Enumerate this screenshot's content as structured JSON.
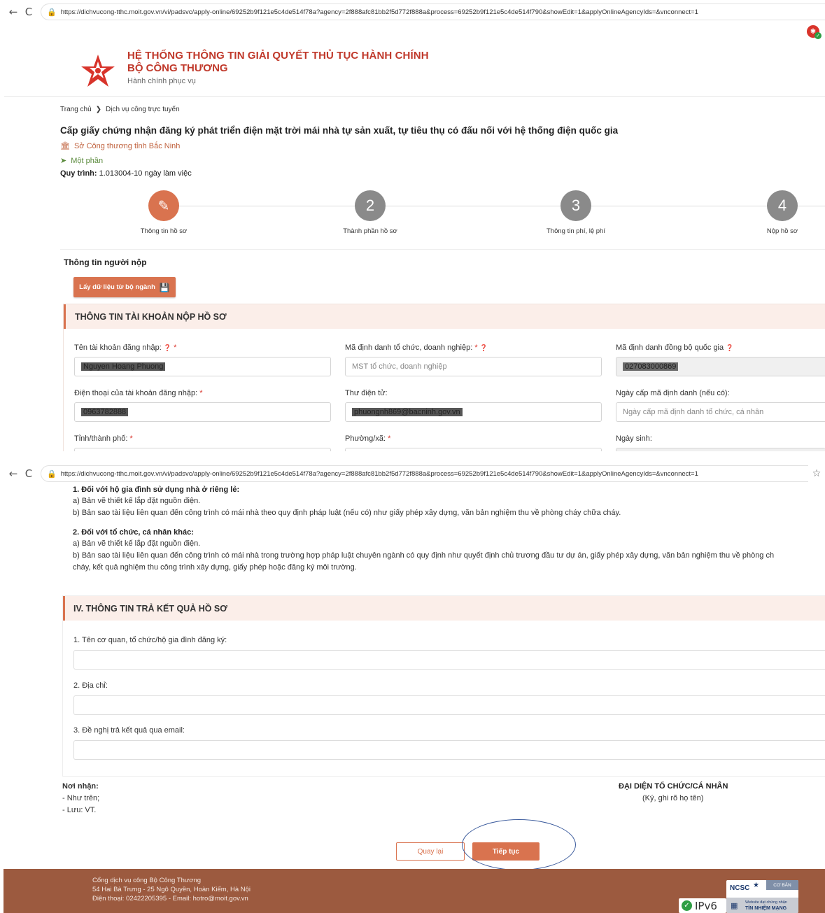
{
  "browser": {
    "url": "https://dichvucong-tthc.moit.gov.vn/vi/padsvc/apply-online/69252b9f121e5c4de514f78a?agency=2f888afc81bb2f5d772f888a&process=69252b9f121e5c4de514f790&showEdit=1&applyOnlineAgencyIds=&vnconnect=1",
    "back_glyph": "←",
    "reload_glyph": "C",
    "lock_glyph": "🔒",
    "star_glyph": "☆"
  },
  "header": {
    "title_line1": "HỆ THỐNG THÔNG TIN GIẢI QUYẾT THỦ TỤC HÀNH CHÍNH",
    "title_line2": "BỘ CÔNG THƯƠNG",
    "subtitle": "Hành chính phục vụ"
  },
  "breadcrumb": {
    "home": "Trang chủ",
    "separator": "❯",
    "current": "Dịch vụ công trực tuyến"
  },
  "procedure": {
    "title": "Cấp giấy chứng nhận đăng ký phát triển điện mặt trời mái nhà tự sản xuất, tự tiêu thụ có đấu nối với hệ thống điện quốc gia",
    "agency": "Sở Công thương tỉnh Bắc Ninh",
    "agency_icon": "🏛",
    "level": "Một phần",
    "level_icon": "➤",
    "process_label": "Quy trình:",
    "process_value": "1.013004-10 ngày làm việc"
  },
  "steps": [
    {
      "number": "✎",
      "label": "Thông tin hồ sơ",
      "active": true
    },
    {
      "number": "2",
      "label": "Thành phần hồ sơ",
      "active": false
    },
    {
      "number": "3",
      "label": "Thông tin phí, lệ phí",
      "active": false
    },
    {
      "number": "4",
      "label": "Nộp hồ sơ",
      "active": false
    }
  ],
  "submitter": {
    "section_title": "Thông tin người nộp",
    "fetch_button": "Lấy dữ liệu từ bộ ngành",
    "fetch_icon": "💾"
  },
  "account_panel": {
    "title": "THÔNG TIN TÀI KHOẢN NỘP HỒ SƠ",
    "help_glyph": "❓",
    "required_mark": "*",
    "fields": {
      "username": {
        "label": "Tên tài khoản đăng nhập:",
        "value": "Nguyen Hoang Phuong"
      },
      "org_id": {
        "label": "Mã định danh tổ chức, doanh nghiệp:",
        "placeholder": "MST tổ chức, doanh nghiệp"
      },
      "national_id": {
        "label": "Mã định danh đồng bộ quốc gia",
        "value": "027083000869"
      },
      "phone": {
        "label": "Điện thoại của tài khoản đăng nhập:",
        "value": "0963782888"
      },
      "email": {
        "label": "Thư điện tử:",
        "value": "phuongnh869@bacninh.gov.vn"
      },
      "id_date": {
        "label": "Ngày cấp mã định danh (nếu có):",
        "placeholder": "Ngày cấp mã định danh tổ chức, cá nhân"
      },
      "province": {
        "label": "Tỉnh/thành phố:"
      },
      "ward": {
        "label": "Phường/xã:"
      },
      "birthday": {
        "label": "Ngày sinh:"
      }
    }
  },
  "requirements": {
    "household_title": "1. Đối với hộ gia đình sử dụng nhà ở riêng lẻ:",
    "household_a": "a) Bản vẽ thiết kế lắp đặt nguồn điện.",
    "household_b": "b) Bản sao tài liệu liên quan đến công trình có mái nhà theo quy định pháp luật (nếu có) như giấy phép xây dựng, văn bản nghiệm thu về phòng cháy chữa cháy.",
    "other_title": "2. Đối với tổ chức, cá nhân khác:",
    "other_a": "a) Bản vẽ thiết kế lắp đặt nguồn điện.",
    "other_b": "b) Bản sao tài liệu liên quan đến công trình có mái nhà trong trường hợp pháp luật chuyên ngành có quy định như quyết định chủ trương đầu tư dự án, giấy phép xây dựng, văn bản nghiệm thu về phòng ch",
    "other_b2": "cháy, kết quả nghiệm thu công trình xây dựng, giấy phép hoặc đăng ký môi trường."
  },
  "result_panel": {
    "title": "IV. THÔNG TIN TRẢ KẾT QUẢ HỒ SƠ",
    "field1": "1. Tên cơ quan, tổ chức/hộ gia đình đăng ký:",
    "field2": "2. Địa chỉ:",
    "field3": "3. Đề nghị trả kết quả qua email:"
  },
  "recipients": {
    "title": "Nơi nhận:",
    "line1": "- Như trên;",
    "line2": "- Lưu: VT."
  },
  "signature": {
    "title": "ĐẠI DIỆN TỔ CHỨC/CÁ NHÂN",
    "note": "(Ký, ghi rõ họ tên)"
  },
  "actions": {
    "back": "Quay lại",
    "next": "Tiếp tục"
  },
  "footer": {
    "line1": "Cổng dịch vụ công Bộ Công Thương",
    "line2": "54 Hai Bà Trưng - 25 Ngô Quyền, Hoàn Kiếm, Hà Nội",
    "line3": "Điện thoại: 02422205395 - Email: hotro@moit.gov.vn",
    "ipv6": "IPv6",
    "ncsc": "NCSC",
    "ncsc_level": "CƠ BẢN",
    "ncsc_sub": "Website đạt chứng nhận",
    "ncsc_trust": "TÍN NHIỆM MẠNG"
  },
  "colors": {
    "brand_red": "#c0392b",
    "accent_orange": "#d9734f",
    "footer_brown": "#9c5a3f"
  }
}
